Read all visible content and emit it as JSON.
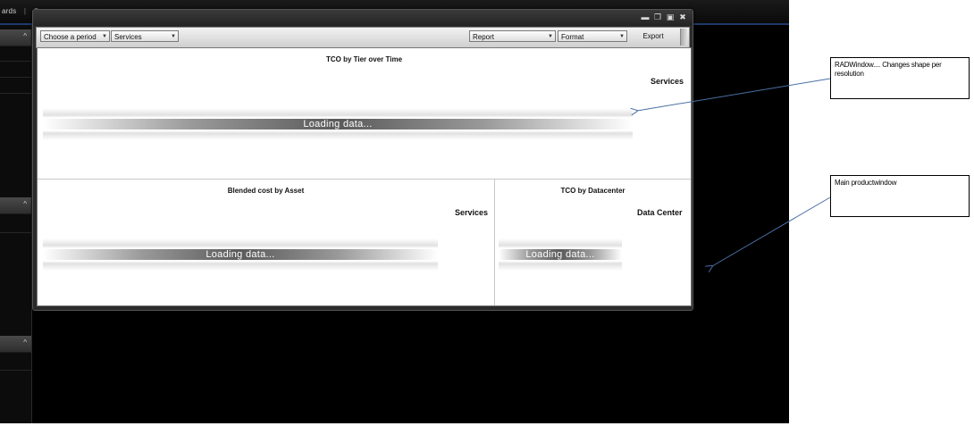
{
  "app": {
    "nav_text": "ards",
    "nav_sep": "|",
    "nav_next": "C"
  },
  "sidebar": {
    "chevron": "^"
  },
  "rad_window": {
    "controls": [
      "minimize",
      "restore",
      "maximize",
      "close"
    ],
    "toolbar": {
      "period_select": "Choose a period",
      "services_select": "Services",
      "report_select": "Report",
      "format_select": "Format",
      "export_label": "Export"
    },
    "panels": {
      "top": {
        "title": "TCO by Tier over Time",
        "legend": "Services",
        "loading": "Loading data..."
      },
      "bottom_left": {
        "title": "Blended cost by Asset",
        "legend": "Services",
        "loading": "Loading data..."
      },
      "bottom_right": {
        "title": "TCO by Datacenter",
        "legend": "Data Center",
        "loading": "Loading data..."
      }
    }
  },
  "annotations": {
    "radwindow_note": "RADWindow.... Changes shape per resolution",
    "main_note": "Main productwindow"
  },
  "colors": {
    "app_background": "#000000",
    "accent_line": "#1d3a6b",
    "arrow": "#4a6fa5"
  }
}
